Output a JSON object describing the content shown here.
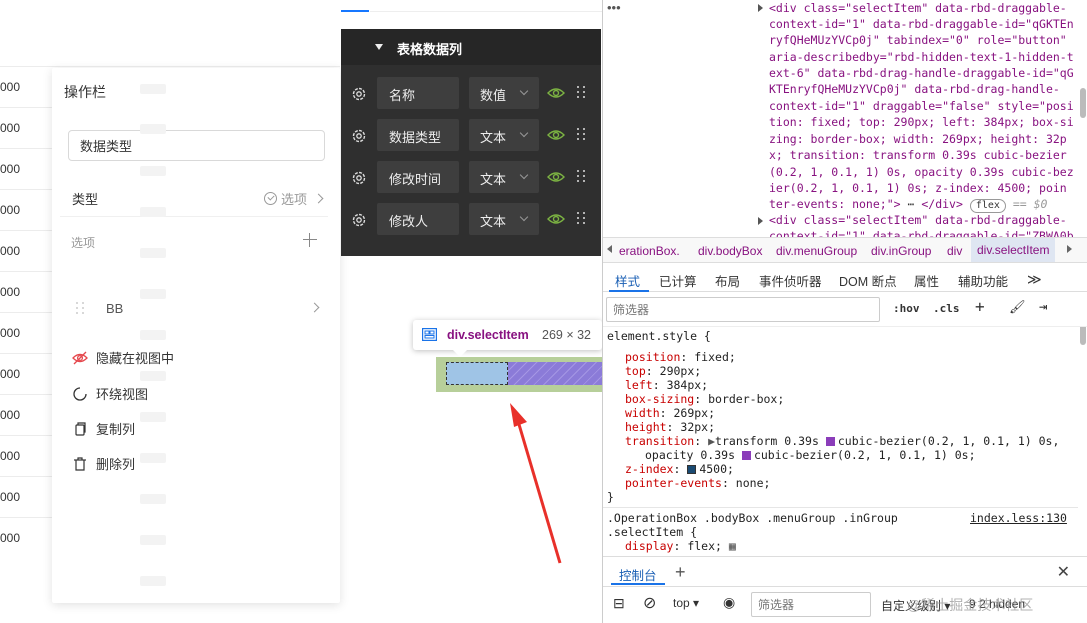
{
  "background_table": {
    "cells": [
      "000",
      "000",
      "000",
      "000",
      "000",
      "000",
      "000",
      "000",
      "000",
      "000",
      "000",
      "000"
    ]
  },
  "operation_panel": {
    "title": "操作栏",
    "name_input_value": "数据类型",
    "type_label": "类型",
    "type_value": "选项",
    "options_label": "选项",
    "option_item": "BB",
    "actions": {
      "hide": "隐藏在视图中",
      "around": "环绕视图",
      "copy": "复制列",
      "delete": "删除列"
    }
  },
  "column_panel": {
    "title": "表格数据列",
    "rows": [
      {
        "name": "名称",
        "type": "数值"
      },
      {
        "name": "数据类型",
        "type": "文本"
      },
      {
        "name": "修改时间",
        "type": "文本"
      },
      {
        "name": "修改人",
        "type": "文本"
      }
    ]
  },
  "inspect_tooltip": {
    "element": "div.selectItem",
    "size": "269 × 32"
  },
  "devtools": {
    "elements_lines": [
      "<div class=\"selectItem\" data-rbd-draggable-",
      "context-id=\"1\" data-rbd-draggable-id=\"qGKTEn",
      "ryfQHeMUzYVCp0j\" tabindex=\"0\" role=\"button\"",
      "aria-describedby=\"rbd-hidden-text-1-hidden-t",
      "ext-6\" data-rbd-drag-handle-draggable-id=\"qG",
      "KTEnryfQHeMUzYVCp0j\" data-rbd-drag-handle-",
      "context-id=\"1\" draggable=\"false\" style=\"posi",
      "tion: fixed; top: 290px; left: 384px; box-si",
      "zing: border-box; width: 269px; height: 32p",
      "x; transition: transform 0.39s cubic-bezier",
      "(0.2, 1, 0.1, 1) 0s, opacity 0.39s cubic-bez",
      "ier(0.2, 1, 0.1, 1) 0s; z-index: 4500; poin",
      "ter-events: none;\">"
    ],
    "elements_tail": "</div>",
    "flex_badge": "flex",
    "eq0": "== $0",
    "elements_next_1": "<div class=\"selectItem\" data-rbd-draggable-",
    "elements_next_2": "context-id=\"1\" data-rbd-draggable-id=\"ZBWA0b",
    "breadcrumb": [
      "erationBox.",
      "div.bodyBox",
      "div.menuGroup",
      "div.inGroup",
      "div",
      "div.selectItem"
    ],
    "tabs": [
      "样式",
      "已计算",
      "布局",
      "事件侦听器",
      "DOM 断点",
      "属性",
      "辅助功能"
    ],
    "filter_placeholder": "筛选器",
    "hov": ":hov",
    "cls": ".cls",
    "element_style": {
      "header": "element.style {",
      "position": "fixed;",
      "top": "290px;",
      "left": "384px;",
      "box_sizing": "border-box;",
      "width": "269px;",
      "height": "32px;",
      "transition_1": "transform 0.39s",
      "transition_bezier_1": "cubic-bezier(0.2, 1, 0.1, 1) 0s,",
      "transition_2": "opacity 0.39s",
      "transition_bezier_2": "cubic-bezier(0.2, 1, 0.1, 1) 0s;",
      "z_index": "4500;",
      "pointer_events": "none;",
      "close": "}"
    },
    "rule": {
      "selector_1": ".OperationBox .bodyBox .menuGroup .inGroup",
      "selector_2": ".selectItem {",
      "source": "index.less:130",
      "display_prop": "display",
      "display_val": "flex;"
    },
    "console_tab": "控制台",
    "console_top": "top",
    "console_filter": "筛选器",
    "level": "自定义级别",
    "hidden": "9  2 hidden"
  },
  "watermark": "@稀土掘金技术社区",
  "colors": {
    "dark_panel": "#2f2f2f",
    "eye_green": "#7cb342",
    "tag_purple": "#881280",
    "arrow_red": "#e8302a"
  }
}
